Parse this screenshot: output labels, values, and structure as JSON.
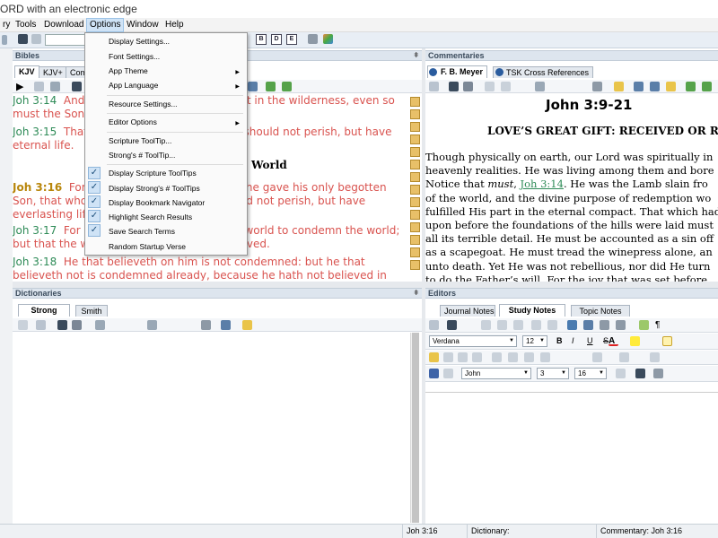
{
  "title": "ORD with an electronic edge",
  "menubar": [
    "ry",
    "Tools",
    "Download",
    "Options",
    "Window",
    "Help"
  ],
  "panes": {
    "bibles": "Bibles",
    "commentaries": "Commentaries",
    "dictionaries": "Dictionaries",
    "editors": "Editors"
  },
  "bible_tabs": [
    "KJV",
    "KJV+",
    "Com"
  ],
  "verses": [
    {
      "ref": "Joh 3:14",
      "text": "And as Moses lifted up the serpent in the wilderness, even so must the Son of man be lifted up:"
    },
    {
      "ref": "Joh 3:15",
      "text": "That whosoever believeth in him should not perish, but have eternal life."
    },
    {
      "ref": "Joh 3:16",
      "text": "For God so loved the world, that he gave his only begotten Son, that whosoever believeth in him should not perish, but have everlasting life."
    },
    {
      "ref": "Joh 3:17",
      "text": "For God sent not his Son into the world to condemn the world; but that the world through him might be saved."
    },
    {
      "ref": "Joh 3:18",
      "text": "He that believeth on him is not condemned: but he that believeth not is condemned already, because he hath not believed in"
    }
  ],
  "bible_heading": "World",
  "commentary_tabs": [
    "F. B. Meyer",
    "TSK Cross References"
  ],
  "commentary": {
    "ref": "John 3:9-21",
    "heading": "LOVE’S GREAT GIFT: RECEIVED OR REJ",
    "lines": [
      "Though physically on earth, our Lord was spiritually in",
      "heavenly realities. He was living among them and bore",
      "Notice that ",
      "of the world, and the divine purpose of redemption wo",
      "fulfilled His part in the eternal compact. That which had",
      "upon before the foundations of the hills were laid must",
      "all its terrible detail. He must be accounted as a sin off",
      "as a scapegoat. He must tread the winepress alone, an",
      "unto death. Yet He was not rebellious, nor did He turn",
      "to do the Father’s will. For the joy that was set before"
    ],
    "line3_em": "must",
    "line3_mid": ", ",
    "line3_link": "Joh 3:14",
    "line3_rest": ". He was the Lamb slain fro"
  },
  "dictionary_tabs": [
    "Strong",
    "Smith"
  ],
  "editor_tabs": [
    "Journal Notes",
    "Study Notes",
    "Topic Notes"
  ],
  "editor_font": "Verdana",
  "editor_size": "12",
  "editor_style": "John",
  "editor_chapter": "3",
  "editor_verse": "16",
  "options_menu": {
    "items": [
      {
        "label": "Display Settings...",
        "arrow": false,
        "checked": false
      },
      {
        "label": "Font Settings...",
        "arrow": false,
        "checked": false
      },
      {
        "label": "App Theme",
        "arrow": true,
        "checked": false
      },
      {
        "label": "App Language",
        "arrow": true,
        "checked": false
      },
      {
        "label": "Resource Settings...",
        "arrow": false,
        "checked": false
      },
      {
        "label": "Editor Options",
        "arrow": true,
        "checked": false
      },
      {
        "label": "Scripture ToolTip...",
        "arrow": false,
        "checked": false
      },
      {
        "label": "Strong's # ToolTip...",
        "arrow": false,
        "checked": false
      },
      {
        "label": "Display Scripture ToolTips",
        "arrow": false,
        "checked": true
      },
      {
        "label": "Display Strong's # ToolTips",
        "arrow": false,
        "checked": true
      },
      {
        "label": "Display Bookmark Navigator",
        "arrow": false,
        "checked": true
      },
      {
        "label": "Highlight Search Results",
        "arrow": false,
        "checked": true
      },
      {
        "label": "Save Search Terms",
        "arrow": false,
        "checked": true
      },
      {
        "label": "Random Startup Verse",
        "arrow": false,
        "checked": false
      }
    ],
    "check_glyph": "✓",
    "arrow_glyph": "▶"
  },
  "statusbar": {
    "verse": "Joh 3:16",
    "dictionary": "Dictionary:",
    "commentary": "Commentary: Joh 3:16"
  },
  "icons": {
    "pin": "ǂ",
    "play": "▶",
    "dropdown": "▼"
  },
  "colors": {
    "verse_ref": "#2e8b57",
    "current_ref": "#b8860b",
    "verse_text": "#d9534f",
    "menu_highlight": "#cfe3f6"
  }
}
